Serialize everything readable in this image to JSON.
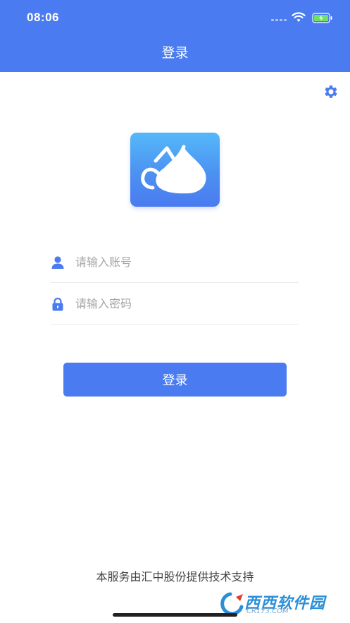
{
  "status_bar": {
    "time": "08:06"
  },
  "header": {
    "title": "登录"
  },
  "form": {
    "account_placeholder": "请输入账号",
    "password_placeholder": "请输入密码",
    "login_label": "登录"
  },
  "footer": {
    "text": "本服务由汇中股份提供技术支持"
  },
  "watermark": {
    "text": "西西软件园",
    "site": "CR173.COM"
  },
  "colors": {
    "primary": "#4a7bf0",
    "logo_gradient_top": "#55b8f9"
  },
  "icons": [
    "wifi-icon",
    "battery-icon",
    "gear-icon",
    "user-icon",
    "lock-icon",
    "app-logo-icon"
  ]
}
